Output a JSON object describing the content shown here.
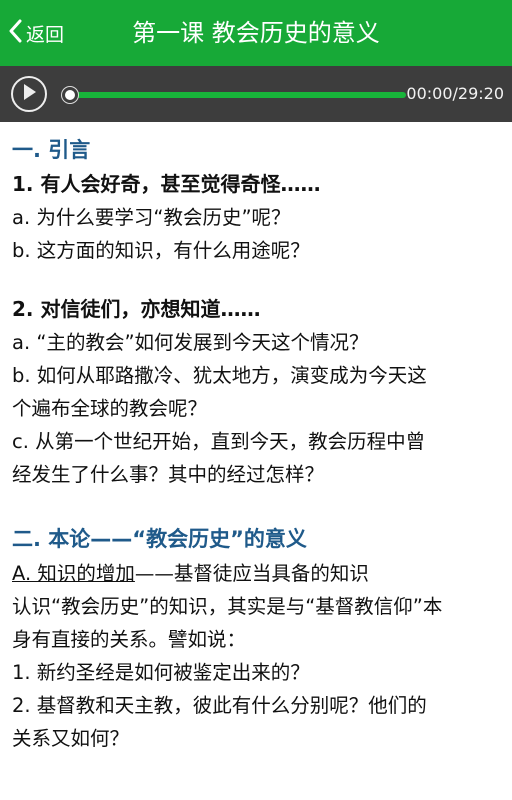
{
  "header": {
    "back_label": "返回",
    "title": "第一课 教会历史的意义",
    "color": "#17a937"
  },
  "player": {
    "time": "00:00/29:20",
    "progress": 0.0
  },
  "content": {
    "s1_heading": "一. 引言",
    "s1_q1": "1. 有人会好奇，甚至觉得奇怪……",
    "s1_q1a": "a. 为什么要学习“教会历史”呢？",
    "s1_q1b": "b. 这方面的知识，有什么用途呢？",
    "s1_q2": "2. 对信徒们，亦想知道……",
    "s1_q2a": "a. “主的教会”如何发展到今天这个情况？",
    "s1_q2b1": "b. 如何从耶路撒冷、犹太地方，演变成为今天这",
    "s1_q2b2": "个遍布全球的教会呢？",
    "s1_q2c1": "c. 从第一个世纪开始，直到今天，教会历程中曾",
    "s1_q2c2": "经发生了什么事？其中的经过怎样？",
    "s2_heading": "二. 本论——“教会历史”的意义",
    "s2_a_title": "A. 知识的增加",
    "s2_a_rest": "——基督徒应当具备的知识",
    "s2_p1_1": "认识“教会历史”的知识，其实是与“基督教信仰”本",
    "s2_p1_2": "身有直接的关系。譬如说：",
    "s2_i1": "1. 新约圣经是如何被鉴定出来的？",
    "s2_i2_1": "2. 基督教和天主教，彼此有什么分别呢？他们的",
    "s2_i2_2": "关系又如何？"
  }
}
